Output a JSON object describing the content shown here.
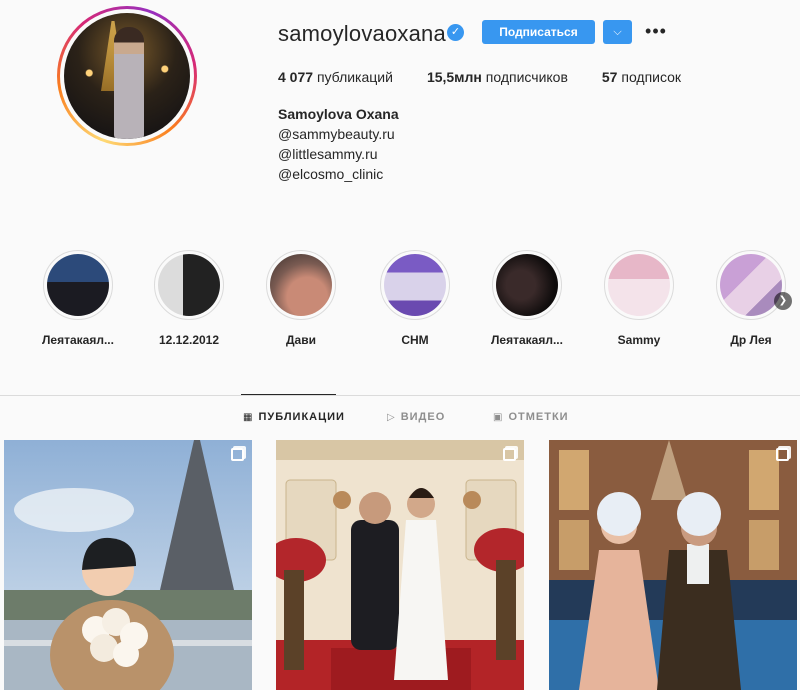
{
  "profile": {
    "username": "samoylovaoxana",
    "verified_mark": "✓",
    "follow_label": "Подписаться",
    "dropdown_icon": "chevron-down-icon",
    "more_label": "•••",
    "stats": {
      "posts_count": "4 077",
      "posts_label": "публикаций",
      "followers_count": "15,5млн",
      "followers_label": "подписчиков",
      "following_count": "57",
      "following_label": "подписок"
    },
    "bio": {
      "name": "Samoylova Oxana",
      "links": [
        "@sammybeauty.ru",
        "@littlesammy.ru",
        "@elcosmo_clinic"
      ]
    }
  },
  "highlights": [
    {
      "label": "Леятакаял..."
    },
    {
      "label": "12.12.2012"
    },
    {
      "label": "Дави"
    },
    {
      "label": "CHM"
    },
    {
      "label": "Леятакаял..."
    },
    {
      "label": "Sammy"
    },
    {
      "label": "Др Лея"
    }
  ],
  "tabs": [
    {
      "label": "ПУБЛИКАЦИИ",
      "icon": "grid-icon",
      "active": true
    },
    {
      "label": "ВИДЕО",
      "icon": "video-icon",
      "active": false
    },
    {
      "label": "ОТМЕТКИ",
      "icon": "tag-icon",
      "active": false
    }
  ],
  "colors": {
    "accent": "#3897f0",
    "text": "#262626",
    "muted": "#8e8e8e",
    "border": "#dbdbdb",
    "background": "#fafafa"
  }
}
